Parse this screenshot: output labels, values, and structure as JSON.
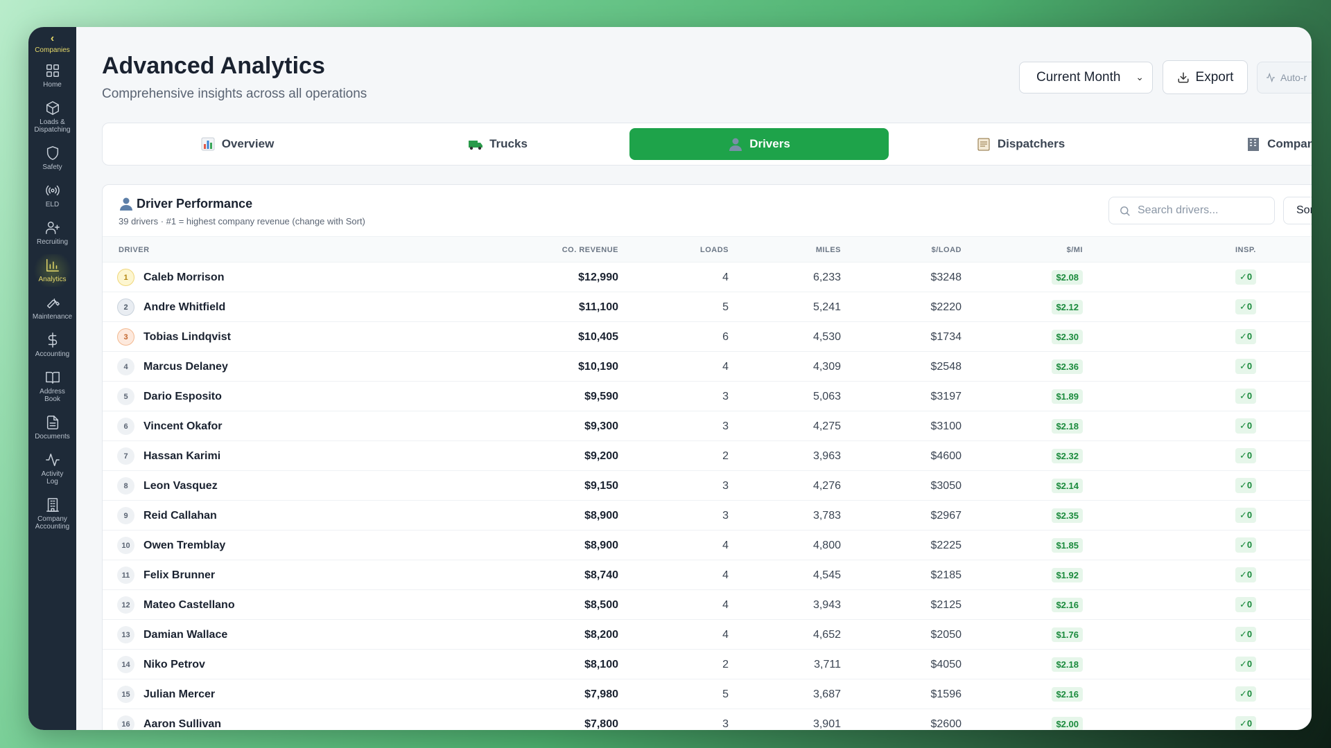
{
  "sidebar": {
    "back_label": "Companies",
    "items": [
      {
        "label": "Home",
        "icon": "grid-icon"
      },
      {
        "label": "Loads &\nDispatching",
        "icon": "box-icon"
      },
      {
        "label": "Safety",
        "icon": "shield-icon"
      },
      {
        "label": "ELD",
        "icon": "radio-icon"
      },
      {
        "label": "Recruiting",
        "icon": "user-plus-icon"
      },
      {
        "label": "Analytics",
        "icon": "bar-chart-icon",
        "active": true
      },
      {
        "label": "Maintenance",
        "icon": "wrench-icon"
      },
      {
        "label": "Accounting",
        "icon": "dollar-icon"
      },
      {
        "label": "Address\nBook",
        "icon": "book-icon"
      },
      {
        "label": "Documents",
        "icon": "file-icon"
      },
      {
        "label": "Activity\nLog",
        "icon": "activity-icon"
      },
      {
        "label": "Company\nAccounting",
        "icon": "building-icon"
      }
    ]
  },
  "header": {
    "title": "Advanced Analytics",
    "subtitle": "Comprehensive insights across all operations",
    "period": "Current Month",
    "export_label": "Export",
    "auto_label": "Auto-r"
  },
  "tabs": [
    {
      "label": "Overview",
      "icon": "chart-emoji"
    },
    {
      "label": "Trucks",
      "icon": "truck-emoji"
    },
    {
      "label": "Drivers",
      "icon": "person-emoji",
      "active": true
    },
    {
      "label": "Dispatchers",
      "icon": "clipboard-emoji"
    },
    {
      "label": "Compani",
      "icon": "building-emoji"
    }
  ],
  "card": {
    "title": "Driver Performance",
    "subtitle": "39 drivers · #1 = highest company revenue (change with Sort)",
    "search_placeholder": "Search drivers...",
    "sort_label": "Sor"
  },
  "table": {
    "headers": {
      "driver": "DRIVER",
      "revenue": "CO. REVENUE",
      "loads": "LOADS",
      "miles": "MILES",
      "per_load": "$/LOAD",
      "per_mile": "$/MI",
      "insp": "INSP."
    },
    "rows": [
      {
        "rank": "1",
        "name": "Caleb Morrison",
        "revenue": "$12,990",
        "loads": "4",
        "miles": "6,233",
        "per_load": "$3248",
        "per_mile": "$2.08",
        "insp": "✓0"
      },
      {
        "rank": "2",
        "name": "Andre Whitfield",
        "revenue": "$11,100",
        "loads": "5",
        "miles": "5,241",
        "per_load": "$2220",
        "per_mile": "$2.12",
        "insp": "✓0"
      },
      {
        "rank": "3",
        "name": "Tobias Lindqvist",
        "revenue": "$10,405",
        "loads": "6",
        "miles": "4,530",
        "per_load": "$1734",
        "per_mile": "$2.30",
        "insp": "✓0"
      },
      {
        "rank": "4",
        "name": "Marcus Delaney",
        "revenue": "$10,190",
        "loads": "4",
        "miles": "4,309",
        "per_load": "$2548",
        "per_mile": "$2.36",
        "insp": "✓0"
      },
      {
        "rank": "5",
        "name": "Dario Esposito",
        "revenue": "$9,590",
        "loads": "3",
        "miles": "5,063",
        "per_load": "$3197",
        "per_mile": "$1.89",
        "insp": "✓0"
      },
      {
        "rank": "6",
        "name": "Vincent Okafor",
        "revenue": "$9,300",
        "loads": "3",
        "miles": "4,275",
        "per_load": "$3100",
        "per_mile": "$2.18",
        "insp": "✓0"
      },
      {
        "rank": "7",
        "name": "Hassan Karimi",
        "revenue": "$9,200",
        "loads": "2",
        "miles": "3,963",
        "per_load": "$4600",
        "per_mile": "$2.32",
        "insp": "✓0"
      },
      {
        "rank": "8",
        "name": "Leon Vasquez",
        "revenue": "$9,150",
        "loads": "3",
        "miles": "4,276",
        "per_load": "$3050",
        "per_mile": "$2.14",
        "insp": "✓0"
      },
      {
        "rank": "9",
        "name": "Reid Callahan",
        "revenue": "$8,900",
        "loads": "3",
        "miles": "3,783",
        "per_load": "$2967",
        "per_mile": "$2.35",
        "insp": "✓0"
      },
      {
        "rank": "10",
        "name": "Owen Tremblay",
        "revenue": "$8,900",
        "loads": "4",
        "miles": "4,800",
        "per_load": "$2225",
        "per_mile": "$1.85",
        "insp": "✓0"
      },
      {
        "rank": "11",
        "name": "Felix Brunner",
        "revenue": "$8,740",
        "loads": "4",
        "miles": "4,545",
        "per_load": "$2185",
        "per_mile": "$1.92",
        "insp": "✓0"
      },
      {
        "rank": "12",
        "name": "Mateo Castellano",
        "revenue": "$8,500",
        "loads": "4",
        "miles": "3,943",
        "per_load": "$2125",
        "per_mile": "$2.16",
        "insp": "✓0"
      },
      {
        "rank": "13",
        "name": "Damian Wallace",
        "revenue": "$8,200",
        "loads": "4",
        "miles": "4,652",
        "per_load": "$2050",
        "per_mile": "$1.76",
        "insp": "✓0"
      },
      {
        "rank": "14",
        "name": "Niko Petrov",
        "revenue": "$8,100",
        "loads": "2",
        "miles": "3,711",
        "per_load": "$4050",
        "per_mile": "$2.18",
        "insp": "✓0"
      },
      {
        "rank": "15",
        "name": "Julian Mercer",
        "revenue": "$7,980",
        "loads": "5",
        "miles": "3,687",
        "per_load": "$1596",
        "per_mile": "$2.16",
        "insp": "✓0"
      },
      {
        "rank": "16",
        "name": "Aaron Sullivan",
        "revenue": "$7,800",
        "loads": "3",
        "miles": "3,901",
        "per_load": "$2600",
        "per_mile": "$2.00",
        "insp": "✓0"
      }
    ]
  }
}
